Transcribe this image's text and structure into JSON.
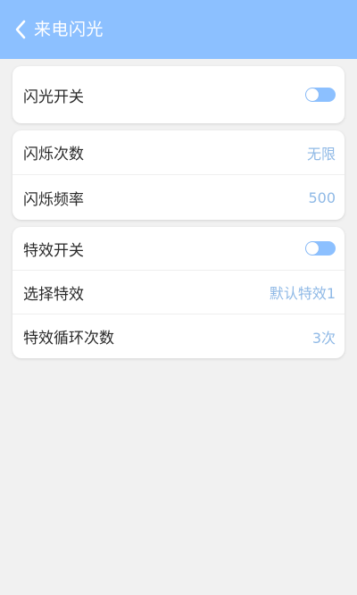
{
  "header": {
    "title": "来电闪光",
    "color": "#8cc0ff"
  },
  "flash_switch_card": {
    "label": "闪光开关",
    "toggle": "on"
  },
  "flash_settings_card": {
    "rows": [
      {
        "label": "闪烁次数",
        "value": "无限"
      },
      {
        "label": "闪烁频率",
        "value": "500"
      }
    ]
  },
  "effect_card": {
    "switch_label": "特效开关",
    "switch_state": "on",
    "rows": [
      {
        "label": "选择特效",
        "value": "默认特效1"
      },
      {
        "label": "特效循环次数",
        "value": "3次"
      }
    ]
  },
  "colors": {
    "accent": "#8cc0ff",
    "value_text": "#8fb9e6",
    "background": "#f1f1f1"
  },
  "icons": {
    "back": "chevron-left-icon",
    "toggle": "toggle-switch"
  }
}
